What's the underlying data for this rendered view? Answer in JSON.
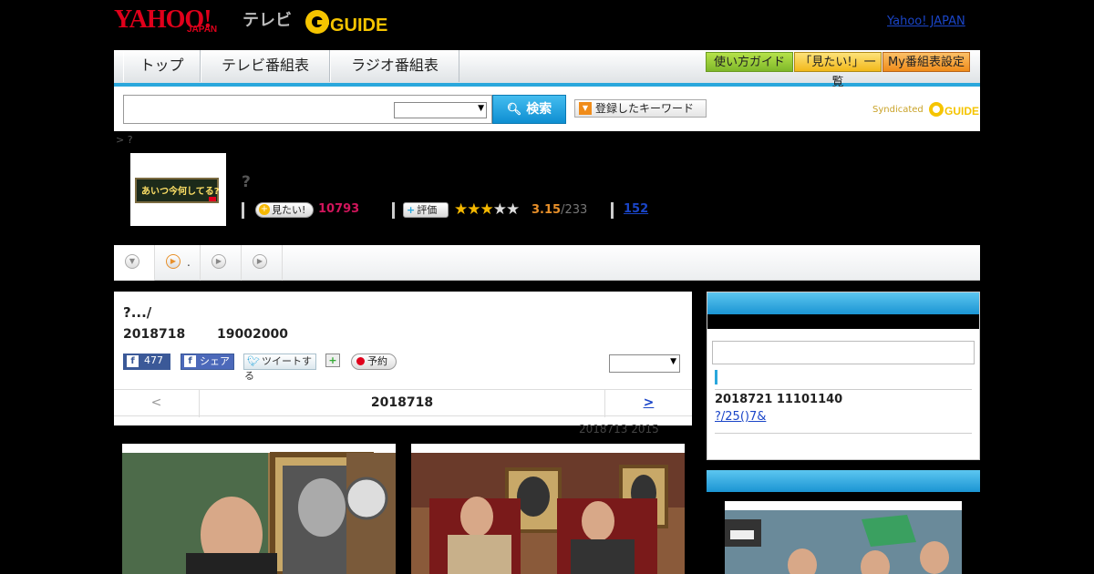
{
  "header": {
    "logo_yahoo": "YAHOO!",
    "logo_japan": "JAPAN",
    "logo_tv": "テレビ",
    "logo_gguide": "GUIDE",
    "link": "Yahoo! JAPAN"
  },
  "nav": {
    "tabs": [
      "トップ",
      "テレビ番組表",
      "ラジオ番組表"
    ],
    "buttons": [
      "使い方ガイド",
      "「見たい!」一覧",
      "My番組表設定"
    ]
  },
  "search": {
    "button_label": "検索",
    "keyword_button": "登録したキーワード",
    "syndicated": "Syndicated"
  },
  "breadcrumb": "> ?",
  "program": {
    "title": "?",
    "want_label": "見たい!",
    "want_count": "10793",
    "rate_label": "評価",
    "rating": "3.15",
    "rating_count": "/233",
    "review_count": "152",
    "stars_filled": 3
  },
  "tabbar": {
    "item2_label": "."
  },
  "episode": {
    "title": "?.../",
    "date": "2018718",
    "time": "19002000",
    "fb_count": "477",
    "share_label": "シェア",
    "tweet_label": "ツイートする",
    "reserve_label": "予約",
    "pager_prev": "<",
    "pager_current": "2018718",
    "pager_next": ">",
    "note": "2018713  2015"
  },
  "sidebar": {
    "date": "2018721  11101140",
    "link": "?/25()7&"
  },
  "colors": {
    "accent_blue": "#2aa7dc",
    "yahoo_red": "#e0001b",
    "want_pink": "#d0155b",
    "gold": "#f5b800"
  }
}
